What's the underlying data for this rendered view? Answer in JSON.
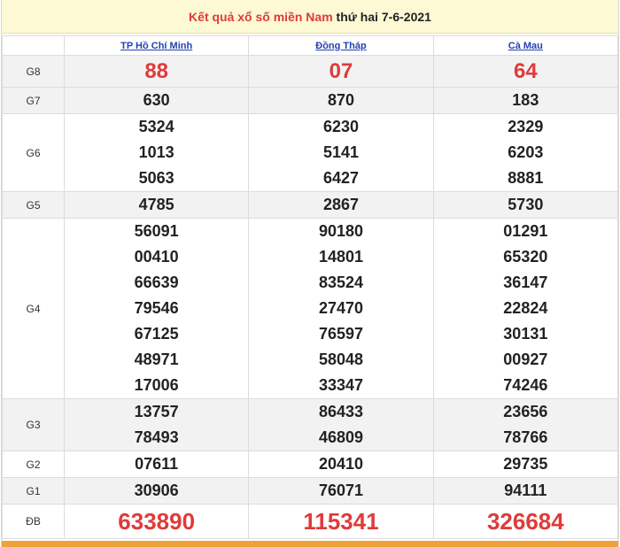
{
  "header": {
    "title_link": "Kết quả xổ số miền Nam",
    "title_rest": " thứ hai 7-6-2021"
  },
  "provinces": [
    "TP Hồ Chí Minh",
    "Đồng Tháp",
    "Cà Mau"
  ],
  "prizes": {
    "G8": {
      "label": "G8",
      "values": [
        [
          "88"
        ],
        [
          "07"
        ],
        [
          "64"
        ]
      ]
    },
    "G7": {
      "label": "G7",
      "values": [
        [
          "630"
        ],
        [
          "870"
        ],
        [
          "183"
        ]
      ]
    },
    "G6": {
      "label": "G6",
      "values": [
        [
          "5324",
          "1013",
          "5063"
        ],
        [
          "6230",
          "5141",
          "6427"
        ],
        [
          "2329",
          "6203",
          "8881"
        ]
      ]
    },
    "G5": {
      "label": "G5",
      "values": [
        [
          "4785"
        ],
        [
          "2867"
        ],
        [
          "5730"
        ]
      ]
    },
    "G4": {
      "label": "G4",
      "values": [
        [
          "56091",
          "00410",
          "66639",
          "79546",
          "67125",
          "48971",
          "17006"
        ],
        [
          "90180",
          "14801",
          "83524",
          "27470",
          "76597",
          "58048",
          "33347"
        ],
        [
          "01291",
          "65320",
          "36147",
          "22824",
          "30131",
          "00927",
          "74246"
        ]
      ]
    },
    "G3": {
      "label": "G3",
      "values": [
        [
          "13757",
          "78493"
        ],
        [
          "86433",
          "46809"
        ],
        [
          "23656",
          "78766"
        ]
      ]
    },
    "G2": {
      "label": "G2",
      "values": [
        [
          "07611"
        ],
        [
          "20410"
        ],
        [
          "29735"
        ]
      ]
    },
    "G1": {
      "label": "G1",
      "values": [
        [
          "30906"
        ],
        [
          "76071"
        ],
        [
          "94111"
        ]
      ]
    },
    "DB": {
      "label": "ĐB",
      "values": [
        [
          "633890"
        ],
        [
          "115341"
        ],
        [
          "326684"
        ]
      ]
    }
  },
  "colors": {
    "accent": "#e03a3a",
    "link": "#2540b0",
    "header_bg": "#fdf9d4",
    "footer_bar": "#f1a13a"
  }
}
